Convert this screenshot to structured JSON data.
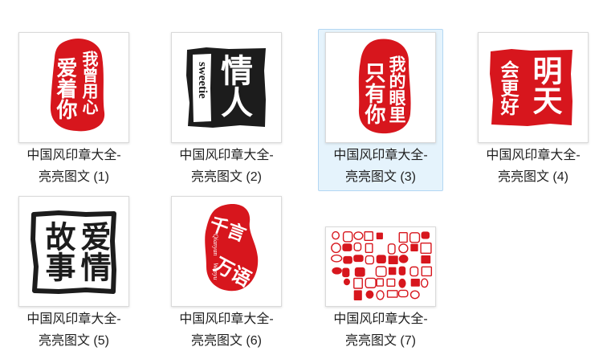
{
  "colors": {
    "seal_red": "#d7161d",
    "ink_black": "#1c1c1c",
    "selection_bg": "#e5f3fc",
    "selection_border": "#b3d7f3",
    "label_text": "#1f1f1f",
    "thumb_border": "#dadada"
  },
  "items": [
    {
      "label_line1": "中国风印章大全-",
      "label_line2": "亮亮图文 (1)",
      "selected": false,
      "seal": {
        "left_column": "爱着你",
        "right_column": "我曾用心"
      }
    },
    {
      "label_line1": "中国风印章大全-",
      "label_line2": "亮亮图文 (2)",
      "selected": false,
      "seal": {
        "main": "情人",
        "latin": "sweetie"
      }
    },
    {
      "label_line1": "中国风印章大全-",
      "label_line2": "亮亮图文 (3)",
      "selected": true,
      "seal": {
        "left_column": "只有你",
        "right_column": "我的眼里"
      }
    },
    {
      "label_line1": "中国风印章大全-",
      "label_line2": "亮亮图文 (4)",
      "selected": false,
      "seal": {
        "left_column": "会更好",
        "right_column": "明天"
      }
    },
    {
      "label_line1": "中国风印章大全-",
      "label_line2": "亮亮图文 (5)",
      "selected": false,
      "seal": {
        "text": "爱情故事"
      }
    },
    {
      "label_line1": "中国风印章大全-",
      "label_line2": "亮亮图文 (6)",
      "selected": false,
      "seal": {
        "line1": "千言",
        "line2": "万语",
        "latin_1": "Qianyan",
        "latin_2": "Wanyu"
      }
    },
    {
      "label_line1": "中国风印章大全-",
      "label_line2": "亮亮图文 (7)",
      "selected": false
    }
  ]
}
